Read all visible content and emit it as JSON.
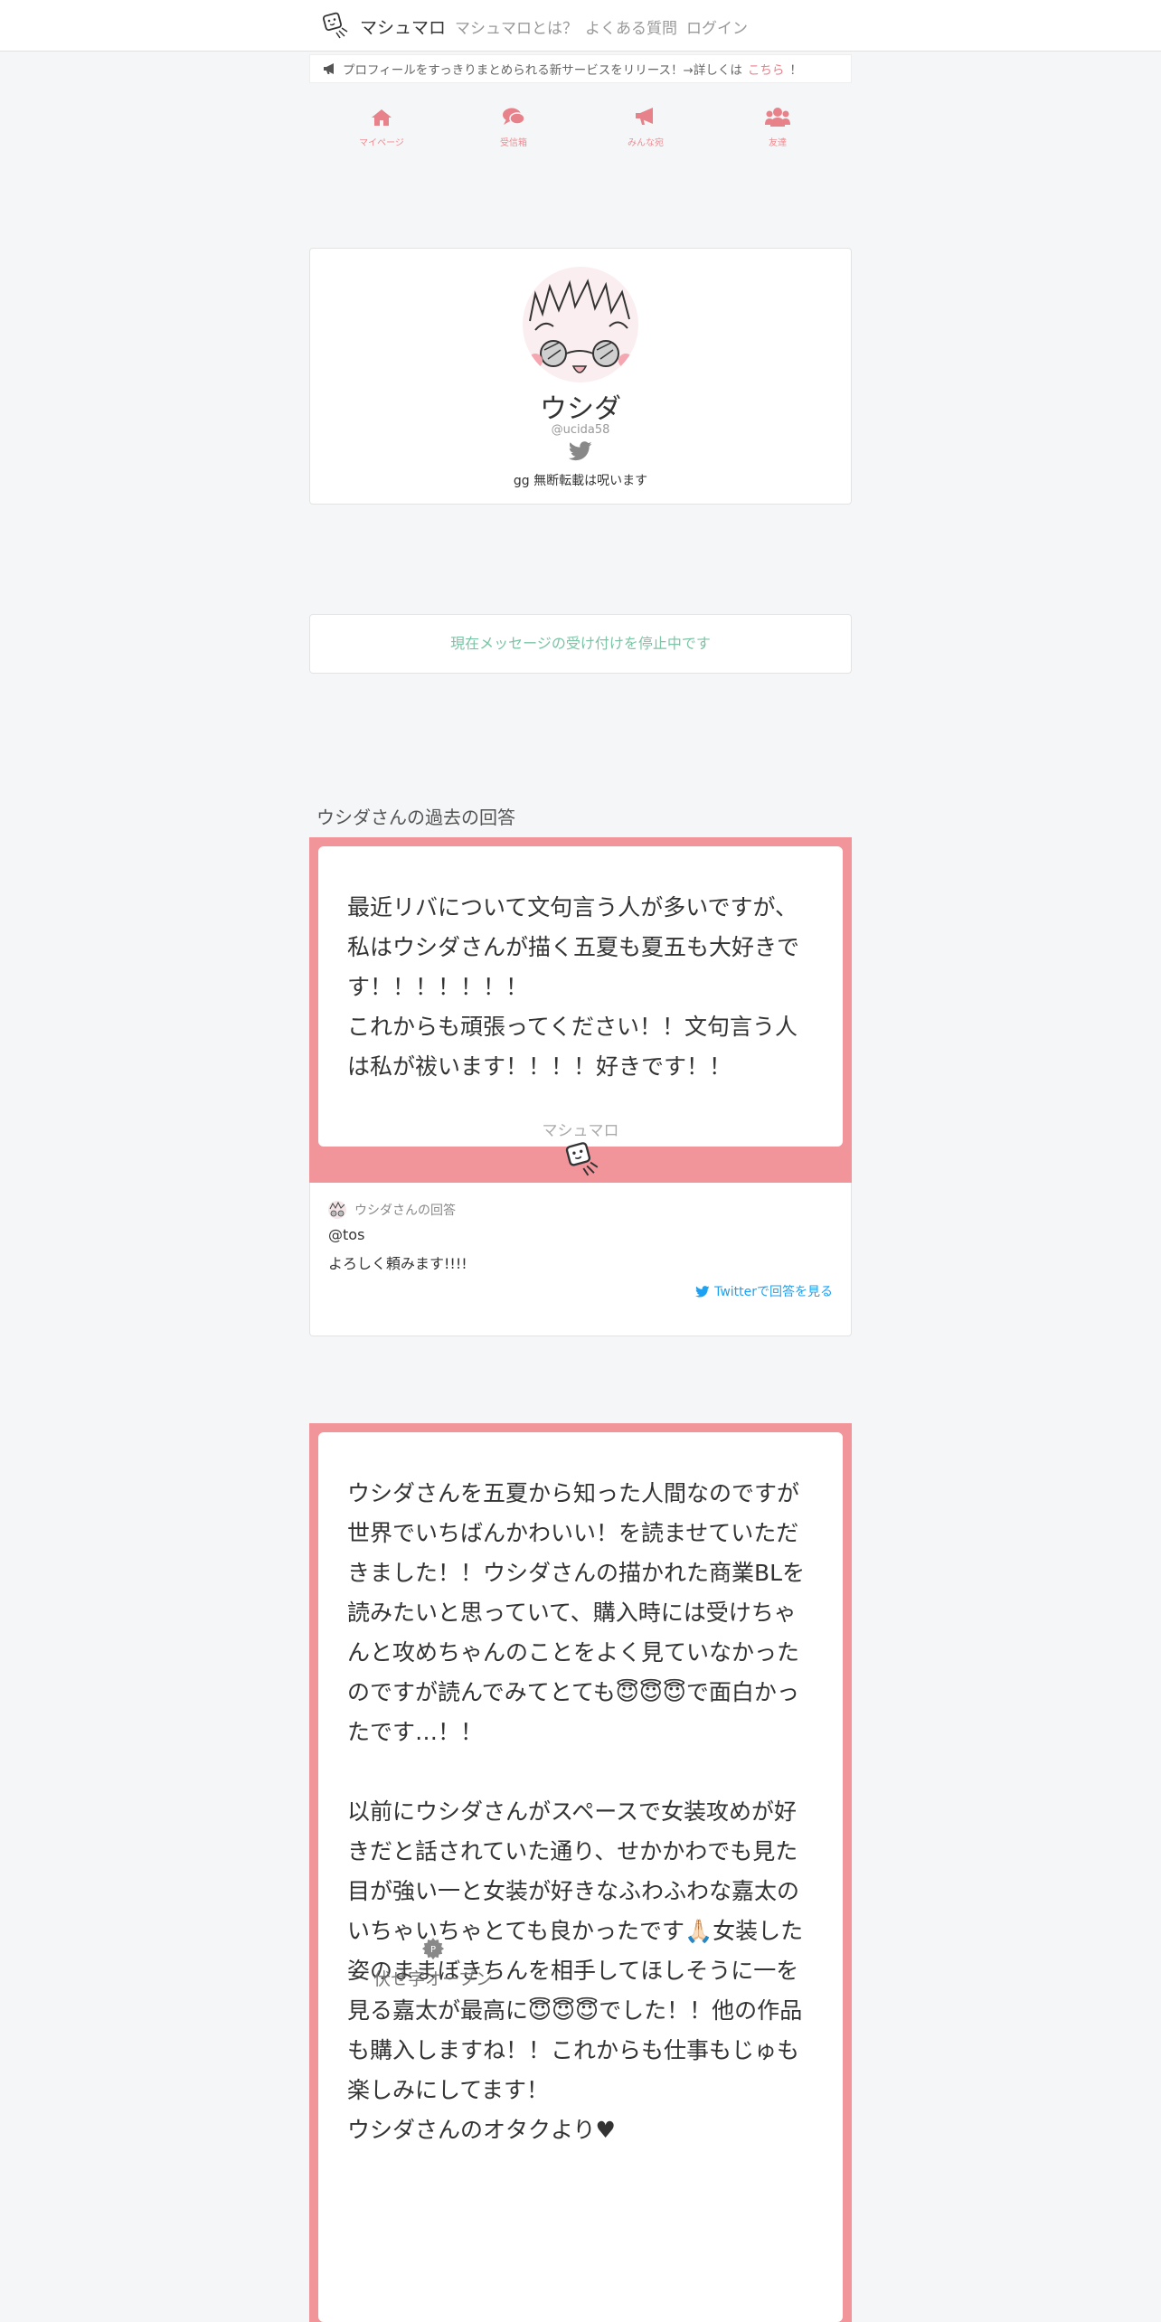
{
  "nav": {
    "brand": "マシュマロ",
    "links": [
      "マシュマロとは？",
      "よくある質問",
      "ログイン"
    ]
  },
  "announcement": {
    "text": "プロフィールをすっきりまとめられる新サービスをリリース！→詳しくは",
    "link": "こちら",
    "suffix": "！"
  },
  "tabs": [
    {
      "label": "マイページ",
      "icon": "home-icon"
    },
    {
      "label": "受信箱",
      "icon": "comments-icon"
    },
    {
      "label": "みんな宛",
      "icon": "megaphone-icon"
    },
    {
      "label": "友達",
      "icon": "users-icon"
    }
  ],
  "profile": {
    "name": "ウシダ",
    "handle": "@ucida58",
    "bio": "gg 無断転載は呪います"
  },
  "status": "現在メッセージの受け付けを停止中です",
  "past_answers_title": "ウシダさんの過去の回答",
  "marshmallows": [
    {
      "text": "最近リバについて文句言う人が多いですが、私はウシダさんが描く五夏も夏五も大好きです！！！！！！！\nこれからも頑張ってください！！文句言う人は私が祓います！！！！好きです！！",
      "footer": "マシュマロ",
      "answer_by": "ウシダさんの回答",
      "answer_lines": [
        "@tos",
        "よろしく頼みます!!!!"
      ],
      "twitter_link": "Twitterで回答を見る"
    },
    {
      "text": "ウシダさんを五夏から知った人間なのですが世界でいちばんかわいい！を読ませていただきました！！ウシダさんの描かれた商業BLを読みたいと思っていて、購入時には受けちゃんと攻めちゃんのことをよく見ていなかったのですが読んでみてとても😇😇😇で面白かったです…！！\n\n以前にウシダさんがスペースで女装攻めが好きだと話されていた通り、せかかわでも見た目が強い一と女装が好きなふわふわな嘉太のいちゃいちゃとても良かったです🙏🏻女装した姿のままぼきちんを相手してほしそうに一を見る嘉太が最高に😇😇😇でした！！他の作品も購入しますね！！これからも仕事もじゅも楽しみにしてます！\nウシダさんのオタクより♥",
      "spoiler_label": "伏せ字オープン"
    }
  ],
  "colors": {
    "accent": "#f1959a",
    "link": "#1da1f2",
    "status": "#7cc4a6"
  }
}
